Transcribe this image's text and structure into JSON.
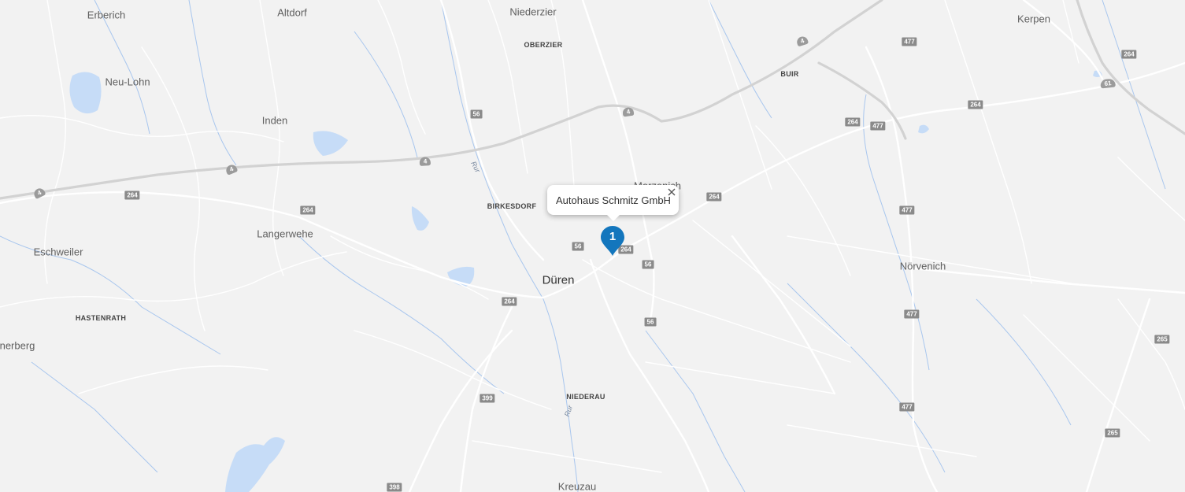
{
  "map": {
    "colors": {
      "background": "#f2f2f2",
      "water": "#c6dcf7",
      "river": "#a8c6ee",
      "road": "#ffffff",
      "highway": "#d2d2d2",
      "shield": "#8a8a8a",
      "marker": "#1376bd"
    },
    "place_labels": {
      "erberich": "Erberich",
      "altdorf": "Altdorf",
      "niederzier": "Niederzier",
      "oberzier": "OBERZIER",
      "kerpen": "Kerpen",
      "buir": "BUIR",
      "neu_lohn": "Neu-Lohn",
      "inden": "Inden",
      "merzenich": "Merzenich",
      "birkesdorf": "BIRKESDORF",
      "langerwehe": "Langerwehe",
      "eschweiler": "Eschweiler",
      "dueren": "Düren",
      "noervenich": "Nörvenich",
      "hastenrath": "HASTENRATH",
      "nerberg": "nerberg",
      "niederau": "NIEDERAU",
      "kreuzau": "Kreuzau"
    },
    "river_labels": {
      "rur_north": "Rur",
      "rur_south": "Rur"
    },
    "road_shields": [
      {
        "text": "4",
        "kind": "highway"
      },
      {
        "text": "4",
        "kind": "highway"
      },
      {
        "text": "4",
        "kind": "highway"
      },
      {
        "text": "4",
        "kind": "highway"
      },
      {
        "text": "4",
        "kind": "highway"
      },
      {
        "text": "61",
        "kind": "highway"
      },
      {
        "text": "477",
        "kind": "road"
      },
      {
        "text": "264",
        "kind": "road"
      },
      {
        "text": "264",
        "kind": "road"
      },
      {
        "text": "477",
        "kind": "road"
      },
      {
        "text": "264",
        "kind": "road"
      },
      {
        "text": "56",
        "kind": "road"
      },
      {
        "text": "264",
        "kind": "road"
      },
      {
        "text": "264",
        "kind": "road"
      },
      {
        "text": "264",
        "kind": "road"
      },
      {
        "text": "477",
        "kind": "road"
      },
      {
        "text": "56",
        "kind": "road"
      },
      {
        "text": "264",
        "kind": "road"
      },
      {
        "text": "56",
        "kind": "road"
      },
      {
        "text": "264",
        "kind": "road"
      },
      {
        "text": "477",
        "kind": "road"
      },
      {
        "text": "56",
        "kind": "road"
      },
      {
        "text": "265",
        "kind": "road"
      },
      {
        "text": "399",
        "kind": "road"
      },
      {
        "text": "477",
        "kind": "road"
      },
      {
        "text": "265",
        "kind": "road"
      },
      {
        "text": "398",
        "kind": "road"
      }
    ]
  },
  "info_window": {
    "title": "Autohaus Schmitz GmbH",
    "close_icon": "close-icon"
  },
  "marker": {
    "label": "1",
    "icon": "map-pin-icon"
  }
}
